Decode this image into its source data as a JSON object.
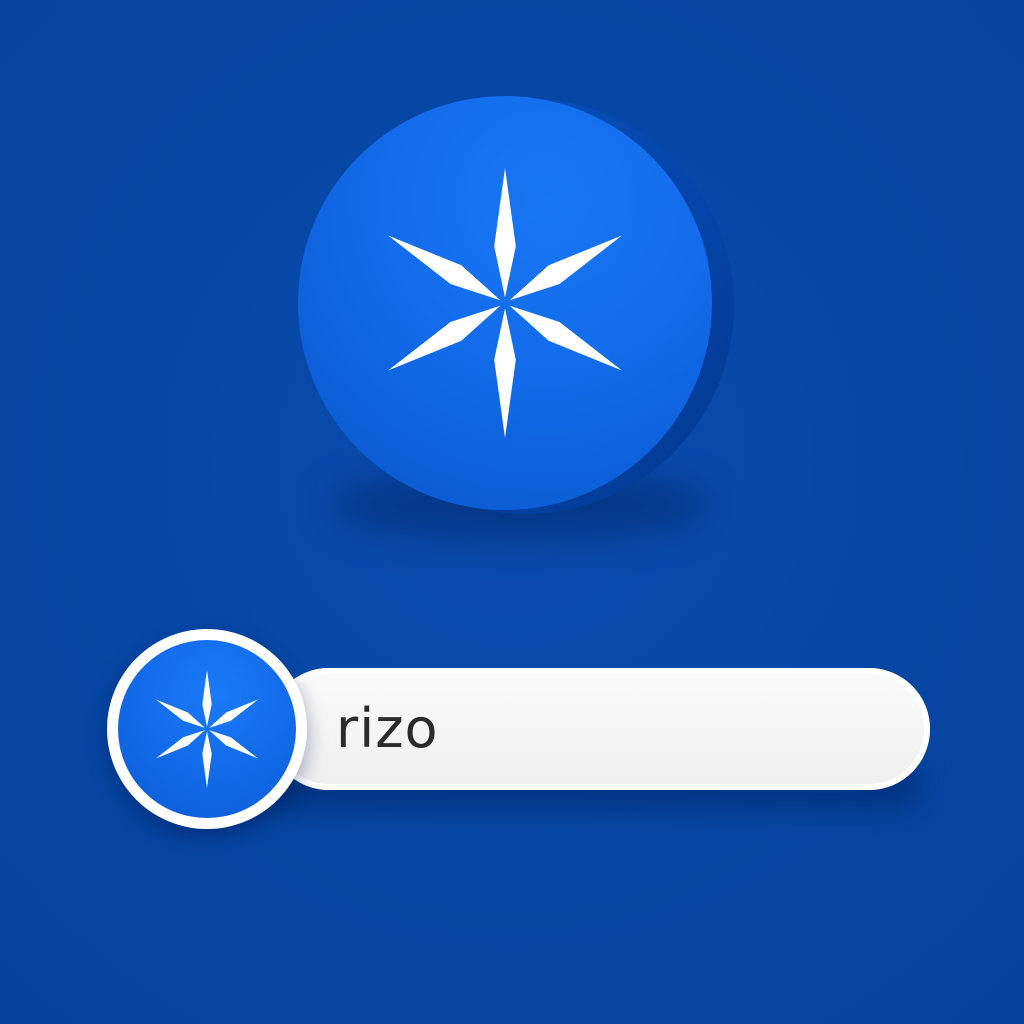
{
  "app_icon": {
    "icon": "six-point-star-icon",
    "color": "#136ceb",
    "glyph_color": "#ffffff"
  },
  "search_bar": {
    "value": "rizo",
    "icon": "six-point-star-icon"
  },
  "background_color": "#0747a6"
}
